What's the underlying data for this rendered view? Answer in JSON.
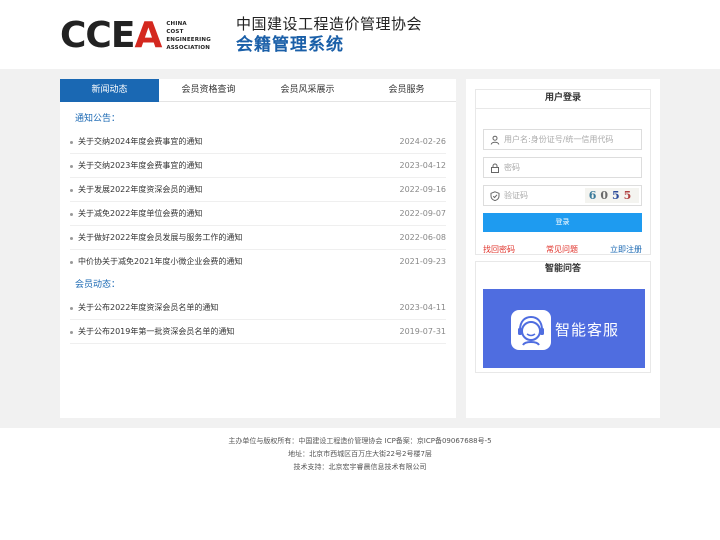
{
  "header": {
    "logo_mark_1": "CCE",
    "logo_mark_2": "A",
    "logo_en": [
      "CHINA",
      "COST",
      "ENGINEERING",
      "ASSOCIATION"
    ],
    "title_line1": "中国建设工程造价管理协会",
    "title_line2": "会籍管理系统"
  },
  "tabs": [
    "新闻动态",
    "会员资格查询",
    "会员风采展示",
    "会员服务"
  ],
  "notice": {
    "title": "通知公告：",
    "items": [
      {
        "title": "关于交纳2024年度会费事宜的通知",
        "date": "2024-02-26"
      },
      {
        "title": "关于交纳2023年度会费事宜的通知",
        "date": "2023-04-12"
      },
      {
        "title": "关于发展2022年度资深会员的通知",
        "date": "2022-09-16"
      },
      {
        "title": "关于减免2022年度单位会费的通知",
        "date": "2022-09-07"
      },
      {
        "title": "关于做好2022年度会员发展与服务工作的通知",
        "date": "2022-06-08"
      },
      {
        "title": "中价协关于减免2021年度小微企业会费的通知",
        "date": "2021-09-23"
      }
    ]
  },
  "member_news": {
    "title": "会员动态：",
    "items": [
      {
        "title": "关于公布2022年度资深会员名单的通知",
        "date": "2023-04-11"
      },
      {
        "title": "关于公布2019年第一批资深会员名单的通知",
        "date": "2019-07-31"
      }
    ]
  },
  "login": {
    "title": "用户登录",
    "username_placeholder": "用户名:身份证号/统一信用代码",
    "password_placeholder": "密码",
    "captcha_placeholder": "验证码",
    "captcha_chars": [
      "6",
      "0",
      "5",
      "5"
    ],
    "submit_label": "登录",
    "links": [
      "找回密码",
      "常见问题",
      "立即注册"
    ]
  },
  "qa": {
    "title": "智能问答",
    "banner_text": "智能客服"
  },
  "footer": {
    "line1": "主办单位与版权所有：中国建设工程造价管理协会    ICP备案：京ICP备09067688号-5",
    "line2": "地址：北京市西城区百万庄大街22号2号楼7层",
    "line3": "技术支持：北京宏宇睿晨信息技术有限公司"
  },
  "colors": {
    "accent": "#1a68b3",
    "login_button": "#1e9bf0",
    "link_red": "#e0322a",
    "banner": "#4f6de0",
    "logo_red": "#d4281f"
  }
}
